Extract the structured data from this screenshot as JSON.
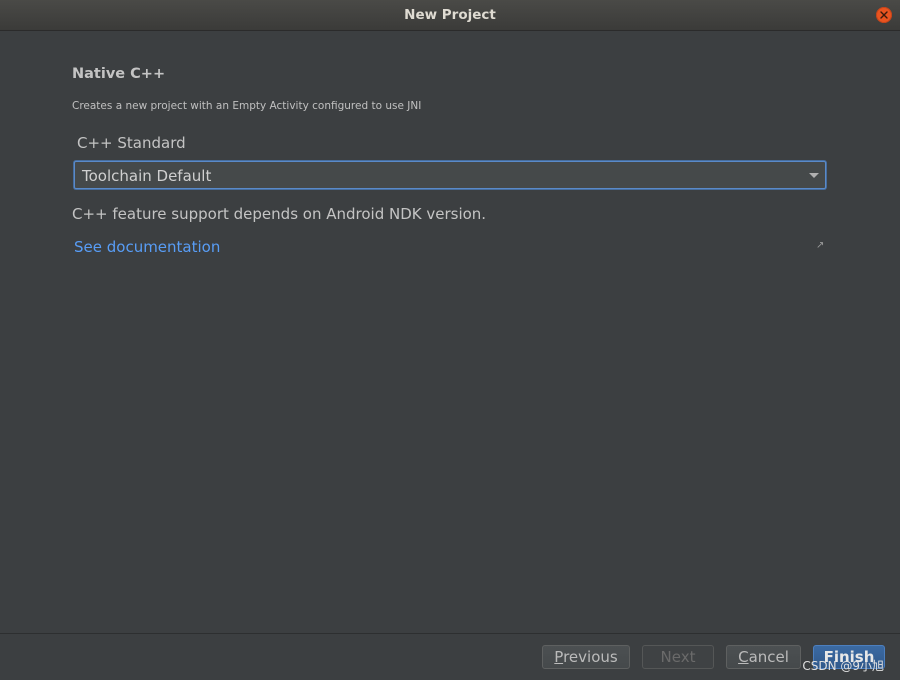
{
  "window": {
    "title": "New Project"
  },
  "page": {
    "title": "Native C++",
    "description": "Creates a new project with an Empty Activity configured to use JNI",
    "cpp_standard": {
      "label": "C++ Standard",
      "selected": "Toolchain Default"
    },
    "info": "C++ feature support depends on Android NDK version.",
    "doc_link": "See documentation"
  },
  "footer": {
    "previous_mnemonic": "P",
    "previous_rest": "revious",
    "next": "Next",
    "cancel_mnemonic": "C",
    "cancel_rest": "ancel",
    "finish": "Finish",
    "watermark": "CSDN @9小旭"
  },
  "colors": {
    "background": "#3c3f41",
    "link": "#589df6",
    "focus_border": "#5a8ac9",
    "primary_button": "#3b6aa3",
    "close_button": "#e95420"
  },
  "icons": {
    "close": "close-icon",
    "dropdown": "chevron-down-icon",
    "external": "external-link-icon"
  }
}
